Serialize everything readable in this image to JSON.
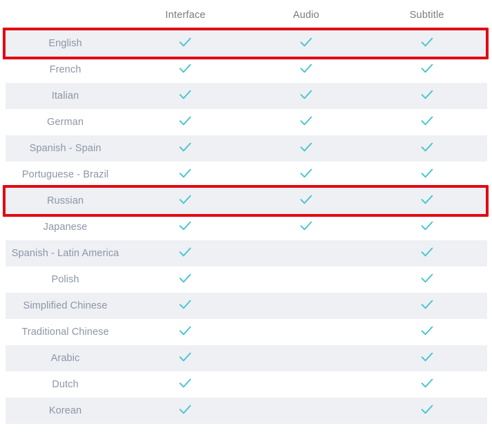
{
  "table": {
    "columns": [
      {
        "key": "language",
        "label": ""
      },
      {
        "key": "interface",
        "label": "Interface"
      },
      {
        "key": "audio",
        "label": "Audio"
      },
      {
        "key": "subtitle",
        "label": "Subtitle"
      }
    ],
    "headers": {
      "language": "",
      "interface": "Interface",
      "audio": "Audio",
      "subtitle": "Subtitle"
    },
    "check_icon": "check-icon",
    "check_color": "#45c4cf",
    "row_shaded_color": "#eef0f4",
    "row_plain_color": "#ffffff",
    "label_color": "#8d95a6",
    "header_color": "#7a7a80",
    "highlight_color": "#e30613",
    "rows": [
      {
        "language": "English",
        "interface": true,
        "audio": true,
        "subtitle": true,
        "shaded": true,
        "highlighted": true
      },
      {
        "language": "French",
        "interface": true,
        "audio": true,
        "subtitle": true,
        "shaded": false,
        "highlighted": false
      },
      {
        "language": "Italian",
        "interface": true,
        "audio": true,
        "subtitle": true,
        "shaded": true,
        "highlighted": false
      },
      {
        "language": "German",
        "interface": true,
        "audio": true,
        "subtitle": true,
        "shaded": false,
        "highlighted": false
      },
      {
        "language": "Spanish - Spain",
        "interface": true,
        "audio": true,
        "subtitle": true,
        "shaded": true,
        "highlighted": false
      },
      {
        "language": "Portuguese - Brazil",
        "interface": true,
        "audio": true,
        "subtitle": true,
        "shaded": false,
        "highlighted": false
      },
      {
        "language": "Russian",
        "interface": true,
        "audio": true,
        "subtitle": true,
        "shaded": true,
        "highlighted": true
      },
      {
        "language": "Japanese",
        "interface": true,
        "audio": true,
        "subtitle": true,
        "shaded": false,
        "highlighted": false
      },
      {
        "language": "Spanish - Latin America",
        "interface": true,
        "audio": false,
        "subtitle": true,
        "shaded": true,
        "highlighted": false
      },
      {
        "language": "Polish",
        "interface": true,
        "audio": false,
        "subtitle": true,
        "shaded": false,
        "highlighted": false
      },
      {
        "language": "Simplified Chinese",
        "interface": true,
        "audio": false,
        "subtitle": true,
        "shaded": true,
        "highlighted": false
      },
      {
        "language": "Traditional Chinese",
        "interface": true,
        "audio": false,
        "subtitle": true,
        "shaded": false,
        "highlighted": false
      },
      {
        "language": "Arabic",
        "interface": true,
        "audio": false,
        "subtitle": true,
        "shaded": true,
        "highlighted": false
      },
      {
        "language": "Dutch",
        "interface": true,
        "audio": false,
        "subtitle": true,
        "shaded": false,
        "highlighted": false
      },
      {
        "language": "Korean",
        "interface": true,
        "audio": false,
        "subtitle": true,
        "shaded": true,
        "highlighted": false
      }
    ]
  }
}
